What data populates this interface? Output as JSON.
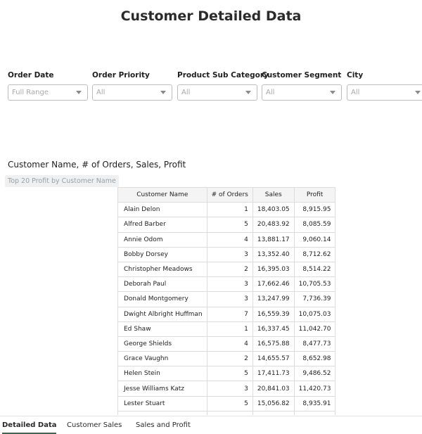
{
  "page": {
    "title": "Customer Detailed Data"
  },
  "filters": [
    {
      "label": "Order Date",
      "value": "Full Range"
    },
    {
      "label": "Order Priority",
      "value": "All"
    },
    {
      "label": "Product Sub Category",
      "value": "All"
    },
    {
      "label": "Customer Segment",
      "value": "All"
    },
    {
      "label": "City",
      "value": "All"
    }
  ],
  "section": {
    "title": "Customer Name, # of Orders, Sales, Profit",
    "chip": "Top 20 Profit by Customer Name"
  },
  "table": {
    "headers": [
      "Customer Name",
      "# of Orders",
      "Sales",
      "Profit"
    ],
    "rows": [
      [
        "Alain Delon",
        "1",
        "18,403.05",
        "8,915.95"
      ],
      [
        "Alfred Barber",
        "5",
        "20,483.92",
        "8,085.59"
      ],
      [
        "Annie Odom",
        "4",
        "13,881.17",
        "9,060.14"
      ],
      [
        "Bobby Dorsey",
        "3",
        "13,352.40",
        "8,712.62"
      ],
      [
        "Christopher Meadows",
        "2",
        "16,395.03",
        "8,514.22"
      ],
      [
        "Deborah Paul",
        "3",
        "17,662.46",
        "10,705.53"
      ],
      [
        "Donald Montgomery",
        "3",
        "13,247.99",
        "7,736.39"
      ],
      [
        "Dwight Albright Huffman",
        "7",
        "16,559.39",
        "10,075.03"
      ],
      [
        "Ed Shaw",
        "1",
        "16,337.45",
        "11,042.70"
      ],
      [
        "George Shields",
        "4",
        "16,575.88",
        "8,477.73"
      ],
      [
        "Grace Vaughn",
        "2",
        "14,655.57",
        "8,652.98"
      ],
      [
        "Helen Stein",
        "5",
        "17,411.73",
        "9,486.52"
      ],
      [
        "Jesse Williams Katz",
        "3",
        "20,841.03",
        "11,420.73"
      ],
      [
        "Lester Stuart",
        "5",
        "15,056.82",
        "8,935.91"
      ]
    ]
  },
  "tabs": [
    {
      "label": "Detailed Data",
      "active": true
    },
    {
      "label": "Customer Sales",
      "active": false
    },
    {
      "label": "Sales and Profit",
      "active": false
    }
  ]
}
